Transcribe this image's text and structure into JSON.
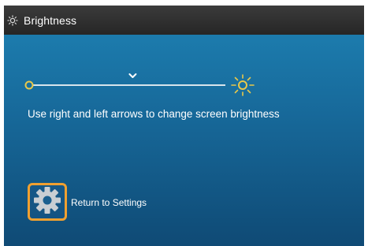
{
  "window": {
    "title": "Brightness",
    "title_icon": "brightness-sun-icon"
  },
  "slider": {
    "min_icon": "dim-circle-icon",
    "max_icon": "bright-sun-icon",
    "handle_icon": "chevron-down-icon",
    "value_fraction": 0.52,
    "accent_color": "#e8c84a"
  },
  "instruction_text": "Use right and left arrows to change screen brightness",
  "settings": {
    "icon": "gear-icon",
    "label": "Return to Settings",
    "border_color": "#f0a030"
  }
}
